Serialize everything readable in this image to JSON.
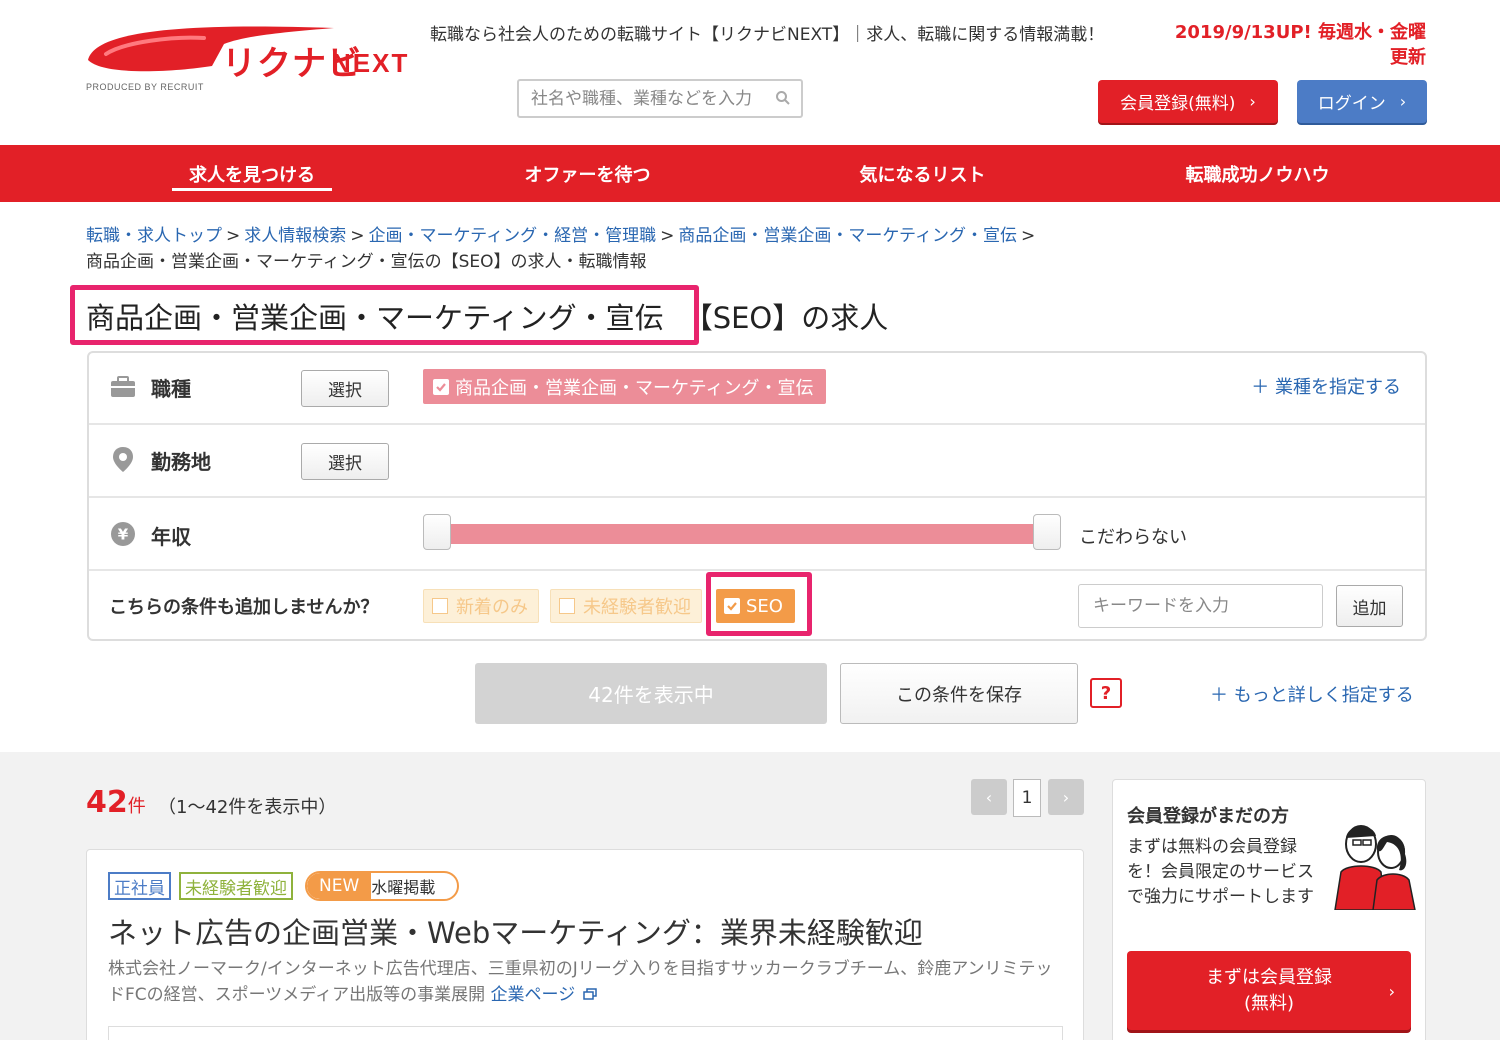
{
  "header": {
    "logo_text": "リクナビ",
    "logo_next": "NEXT",
    "logo_produced": "PRODUCED BY RECRUIT",
    "tagline": "転職なら社会人のための転職サイト【リクナビNEXT】｜求人、転職に関する情報満載！",
    "update_notice": "2019/9/13UP! 毎週水・金曜更新",
    "search_placeholder": "社名や職種、業種などを入力",
    "register_label": "会員登録(無料)",
    "login_label": "ログイン"
  },
  "nav": {
    "items": [
      {
        "label": "求人を見つける",
        "active": true
      },
      {
        "label": "オファーを待つ",
        "active": false
      },
      {
        "label": "気になるリスト",
        "active": false
      },
      {
        "label": "転職成功ノウハウ",
        "active": false
      }
    ]
  },
  "breadcrumb": {
    "links": [
      "転職・求人トップ",
      "求人情報検索",
      "企画・マーケティング・経営・管理職",
      "商品企画・営業企画・マーケティング・宣伝"
    ],
    "current": "商品企画・営業企画・マーケティング・宣伝の【SEO】の求人・転職情報",
    "separator": ">"
  },
  "page_title": {
    "main": "商品企画・営業企画・マーケティング・宣伝",
    "suffix": "【SEO】の求人"
  },
  "filters": {
    "job_type": {
      "label": "職種",
      "select": "選択",
      "chip": "商品企画・営業企画・マーケティング・宣伝",
      "add_link": "＋ 業種を指定する"
    },
    "location": {
      "label": "勤務地",
      "select": "選択"
    },
    "salary": {
      "label": "年収",
      "text": "こだわらない",
      "range_min": 0,
      "range_max": 1
    },
    "conditions": {
      "label": "こちらの条件も追加しませんか？",
      "options": [
        {
          "label": "新着のみ",
          "checked": false
        },
        {
          "label": "未経験者歓迎",
          "checked": false
        },
        {
          "label": "SEO",
          "checked": true
        }
      ],
      "keyword_placeholder": "キーワードを入力",
      "add_label": "追加"
    }
  },
  "actions": {
    "show_label": "42件を表示中",
    "save_label": "この条件を保存",
    "help": "?",
    "more_link": "＋ もっと詳しく指定する"
  },
  "results": {
    "count": "42",
    "count_unit": "件",
    "range": "（1～42件を表示中）",
    "page": "1",
    "prev": "‹",
    "next": "›"
  },
  "job": {
    "tags": [
      "正社員",
      "未経験者歓迎"
    ],
    "new_label": "NEW",
    "day_label": "水曜掲載",
    "title": "ネット広告の企画営業・Webマーケティング：業界未経験歓迎",
    "description": "株式会社ノーマーク/インターネット広告代理店、三重県初のJリーグ入りを目指すサッカークラブチーム、鈴鹿アンリミテッドFCの経営、スポーツメディア出版等の事業展開",
    "company_link": "企業ページ"
  },
  "sidebar": {
    "title": "会員登録がまだの方",
    "description": "まずは無料の会員登録を！会員限定のサービスで強力にサポートします",
    "button_line1": "まずは会員登録",
    "button_line2": "(無料)"
  },
  "colors": {
    "brand_red": "#e22027",
    "highlight_pink": "#e8246d",
    "link_blue": "#2a67b1",
    "chip_pink": "#ec8d98",
    "chip_orange": "#f39b48"
  }
}
